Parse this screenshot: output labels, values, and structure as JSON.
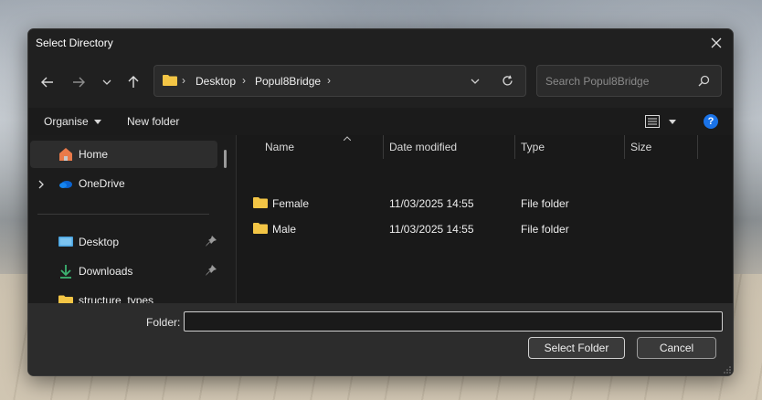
{
  "window": {
    "title": "Select Directory"
  },
  "nav": {
    "breadcrumbs": [
      "Desktop",
      "Popul8Bridge"
    ],
    "search_placeholder": "Search Popul8Bridge"
  },
  "toolbar": {
    "organise_label": "Organise",
    "new_folder_label": "New folder"
  },
  "sidebar": {
    "items": [
      {
        "label": "Home",
        "icon": "home-icon"
      },
      {
        "label": "OneDrive",
        "icon": "onedrive-icon"
      },
      {
        "label": "Desktop",
        "icon": "desktop-icon"
      },
      {
        "label": "Downloads",
        "icon": "download-icon"
      },
      {
        "label": "structure_types",
        "icon": "folder-icon"
      }
    ]
  },
  "filelist": {
    "columns": [
      "Name",
      "Date modified",
      "Type",
      "Size"
    ],
    "rows": [
      {
        "name": "Female",
        "date": "11/03/2025 14:55",
        "type": "File folder",
        "size": ""
      },
      {
        "name": "Male",
        "date": "11/03/2025 14:55",
        "type": "File folder",
        "size": ""
      }
    ]
  },
  "footer": {
    "folder_label": "Folder:",
    "folder_value": "",
    "select_label": "Select Folder",
    "cancel_label": "Cancel"
  },
  "colors": {
    "folder": "#f3c545",
    "accent": "#1a73e8",
    "dialog_bg": "#1f1f1f"
  }
}
